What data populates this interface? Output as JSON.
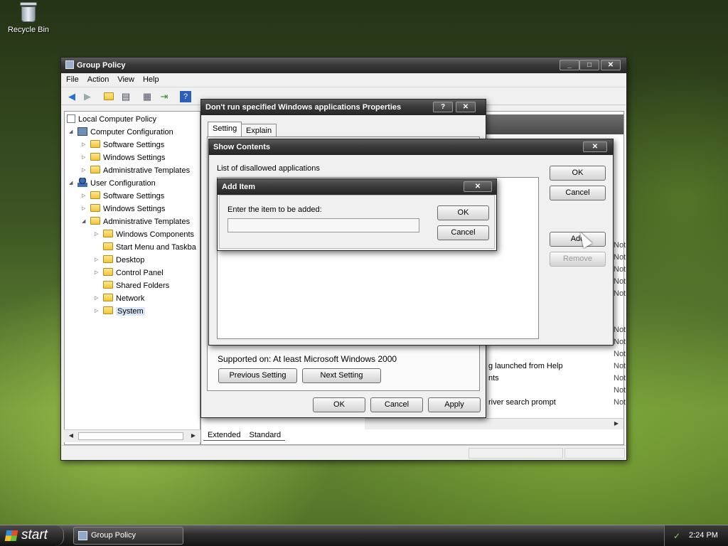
{
  "desktop": {
    "recycle_bin_label": "Recycle Bin"
  },
  "gp": {
    "title": "Group Policy",
    "menu": [
      "File",
      "Action",
      "View",
      "Help"
    ],
    "tree": [
      "Local Computer Policy",
      "Computer Configuration",
      "Software Settings",
      "Windows Settings",
      "Administrative Templates",
      "User Configuration",
      "Software Settings",
      "Windows Settings",
      "Administrative Templates",
      "Windows Components",
      "Start Menu and Taskba",
      "Desktop",
      "Control Panel",
      "Shared Folders",
      "Network",
      "System"
    ],
    "right_state_values": [
      "Not",
      "Not",
      "Not",
      "Not",
      "Not",
      "Not",
      "Not",
      "Not",
      "Not",
      "Not",
      "Not",
      "Not"
    ],
    "right_partial_texts": [
      "g launched from Help",
      "nts",
      "river search prompt"
    ],
    "view_tabs": [
      "Extended",
      "Standard"
    ]
  },
  "props": {
    "title": "Don't run specified Windows applications Properties",
    "tabs": [
      "Setting",
      "Explain"
    ],
    "supported_label": "Supported on:",
    "supported_value": "At least Microsoft Windows 2000",
    "previous_setting": "Previous Setting",
    "next_setting": "Next Setting",
    "ok": "OK",
    "cancel": "Cancel",
    "apply": "Apply"
  },
  "show": {
    "title": "Show Contents",
    "list_label": "List of disallowed applications",
    "ok": "OK",
    "cancel": "Cancel",
    "add": "Add",
    "remove": "Remove"
  },
  "add": {
    "title": "Add Item",
    "prompt": "Enter the item to be added:",
    "value": "",
    "ok": "OK",
    "cancel": "Cancel"
  },
  "taskbar": {
    "start_label": "start",
    "task_label": "Group Policy",
    "clock": "2:24 PM"
  }
}
